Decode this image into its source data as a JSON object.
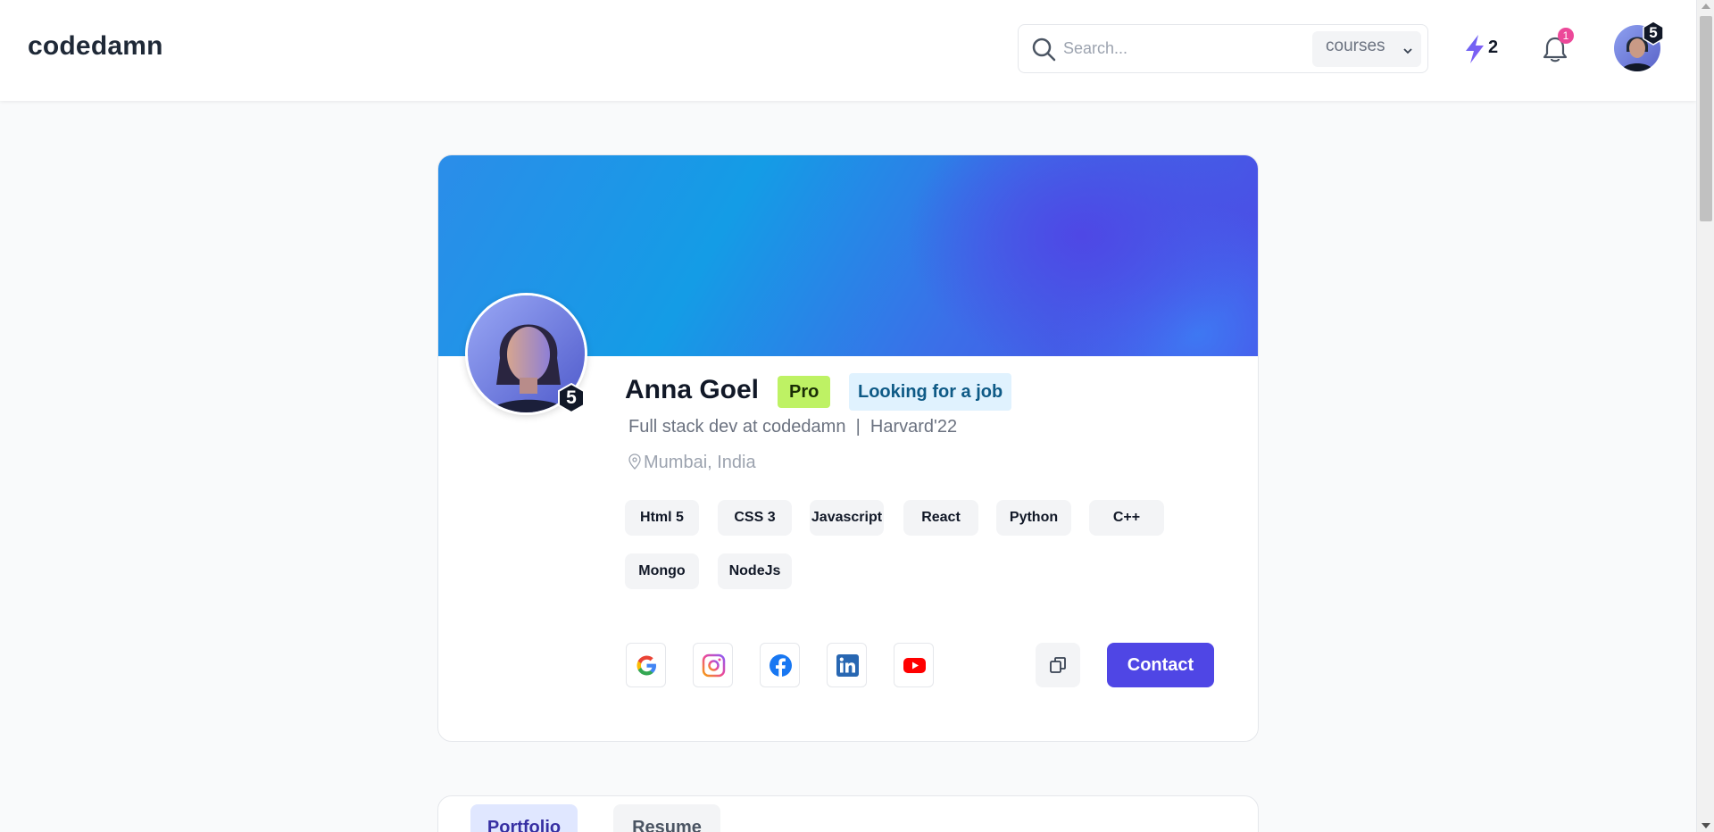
{
  "header": {
    "logo": "codedamn",
    "search_placeholder": "Search...",
    "search_scope": "courses",
    "streak_count": "2",
    "notification_count": "1",
    "level": "5"
  },
  "profile": {
    "name": "Anna Goel",
    "badge_pro": "Pro",
    "badge_status": "Looking for a job",
    "headline": "Full stack dev at codedamn  |  Harvard'22",
    "location": "Mumbai, India",
    "level": "5",
    "skills": [
      "Html 5",
      "CSS 3",
      "Javascript",
      "React",
      "Python",
      "C++",
      "Mongo",
      "NodeJs"
    ],
    "social_icons": [
      "google-icon",
      "instagram-icon",
      "facebook-icon",
      "linkedin-icon",
      "youtube-icon"
    ],
    "contact_label": "Contact"
  },
  "tabs": [
    "Portfolio",
    "Resume"
  ],
  "colors": {
    "accent": "#4f46e5",
    "pro_badge": "#bef264",
    "status_badge": "#e0f2fe",
    "notification_badge": "#ec4899"
  }
}
